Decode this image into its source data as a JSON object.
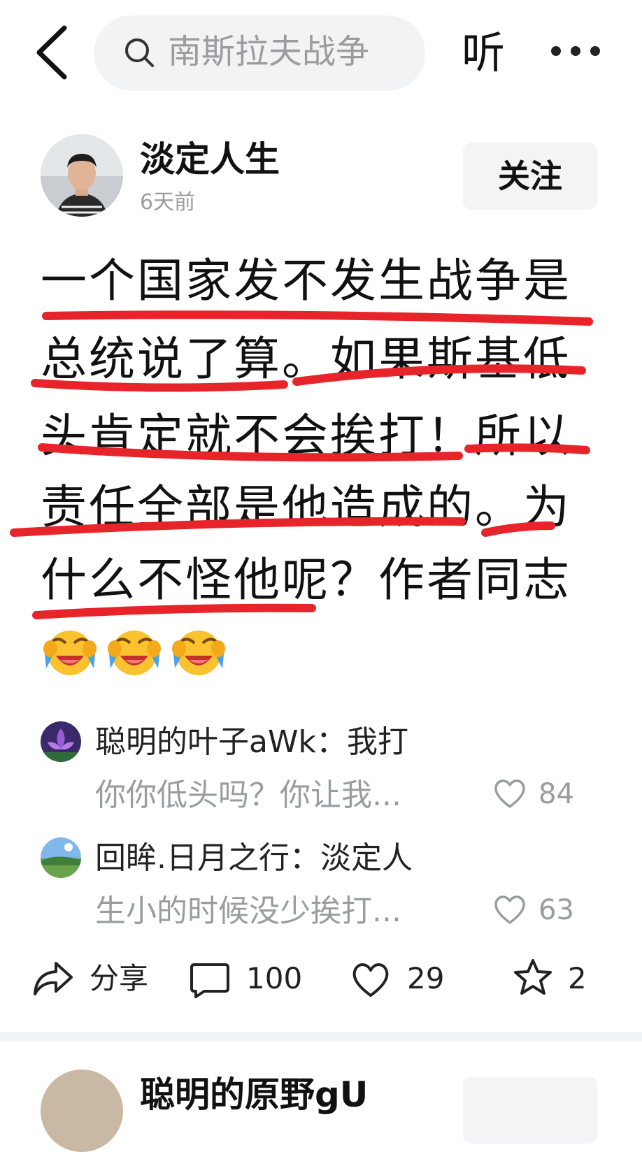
{
  "topbar": {
    "search_text": "南斯拉夫战争",
    "listen_label": "听"
  },
  "post": {
    "author": "淡定人生",
    "time": "6天前",
    "follow_label": "关注",
    "lines": [
      "一个国家发不发生战争是",
      "总统说了算。如果斯基低",
      "头肯定就不会挨打！所以",
      "责任全部是他造成的。为",
      "什么不怪他呢？作者同志"
    ],
    "emoji_name": "laughing-crying-emoji",
    "annotation_color": "#e8242b"
  },
  "comments": [
    {
      "user": "聪明的叶子aWk",
      "line1_rest": "：我打",
      "line2": "你你低头吗？你让我...",
      "likes": "84"
    },
    {
      "user": "回眸.日月之行",
      "line1_rest": "：淡定人",
      "line2": "生小的时候没少挨打...",
      "likes": "63"
    }
  ],
  "actions": {
    "share_label": "分享",
    "comment_count": "100",
    "like_count": "29",
    "favorite_count": "2"
  },
  "next_post": {
    "author": "聪明的原野gU"
  }
}
